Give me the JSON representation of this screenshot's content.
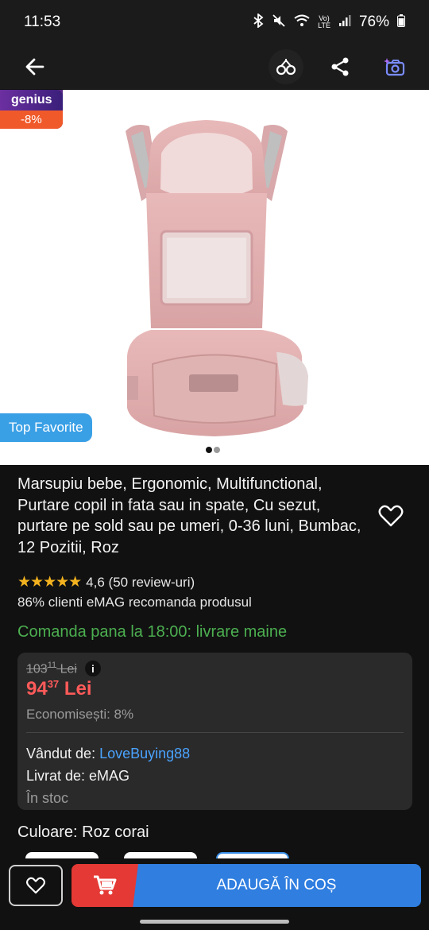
{
  "status_bar": {
    "time": "11:53",
    "battery": "76%",
    "icons": [
      "bluetooth-icon",
      "mute-icon",
      "wifi-icon",
      "volte-icon",
      "signal-icon",
      "battery-icon"
    ]
  },
  "app_bar": {
    "icons": [
      "back-arrow-icon",
      "compare-icon",
      "share-icon",
      "image-search-icon"
    ]
  },
  "gallery": {
    "genius_label": "genius",
    "discount": "-8%",
    "top_favorite": "Top Favorite",
    "slide_count": 2,
    "active_slide": 1
  },
  "product": {
    "title": "Marsupiu bebe, Ergonomic, Multifunctional, Purtare copil in fata sau in spate, Cu sezut, purtare pe sold sau pe umeri, 0-36 luni, Bumbac, 12 Pozitii, Roz",
    "rating_text": "4,6 (50 review-uri)",
    "rating_value": 4.6,
    "recommend_text": "86% clienti eMAG recomanda produsul",
    "delivery_text": "Comanda pana la 18:00: livrare maine"
  },
  "pricing": {
    "old_price_int": "103",
    "old_price_dec": "11",
    "old_price_currency": "Lei",
    "new_price_int": "94",
    "new_price_dec": "37",
    "new_price_currency": "Lei",
    "savings": "Economisești: 8%",
    "seller_label": "Vândut de:",
    "seller_name": "LoveBuying88",
    "delivered_by": "Livrat de: eMAG",
    "stock": "În stoc"
  },
  "color": {
    "label": "Culoare: Roz corai"
  },
  "bottom_bar": {
    "add_to_cart": "ADAUGĂ ÎN COȘ"
  },
  "colors": {
    "accent_blue": "#2f7ee0",
    "cart_red": "#e53935",
    "price_red": "#ff5a5a",
    "delivery_green": "#4caf50",
    "link_blue": "#4aa3ff",
    "star_yellow": "#f3b21f"
  }
}
